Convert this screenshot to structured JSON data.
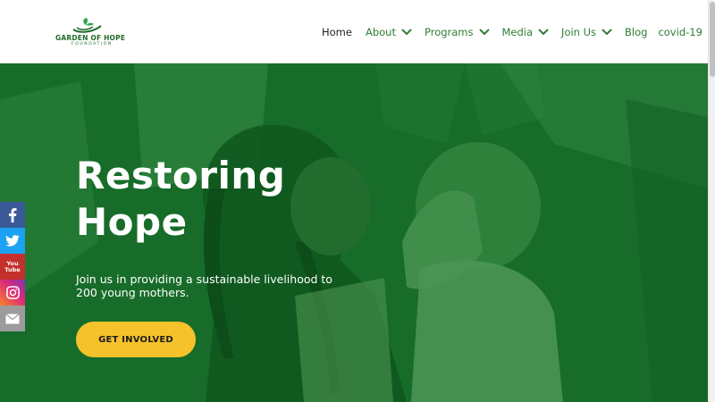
{
  "brand": {
    "title": "GARDEN OF HOPE",
    "subtitle": "FOUNDATION",
    "color": "#1f6b2a"
  },
  "nav": {
    "items": [
      {
        "label": "Home",
        "active": true,
        "dropdown": false
      },
      {
        "label": "About",
        "active": false,
        "dropdown": true
      },
      {
        "label": "Programs",
        "active": false,
        "dropdown": true
      },
      {
        "label": "Media",
        "active": false,
        "dropdown": true
      },
      {
        "label": "Join Us",
        "active": false,
        "dropdown": true
      },
      {
        "label": "Blog",
        "active": false,
        "dropdown": false
      },
      {
        "label": "covid-19",
        "active": false,
        "dropdown": false
      }
    ],
    "link_color": "#2f7d32",
    "active_color": "#222222"
  },
  "hero": {
    "title_line1": "Restoring",
    "title_line2": "Hope",
    "subtitle": "Join us in providing a sustainable livelihood to 200 young mothers.",
    "cta_label": "GET INVOLVED",
    "overlay_color": "#1d6a2c",
    "cta_color": "#f6c22b"
  },
  "social": [
    {
      "name": "facebook",
      "icon": "facebook-icon",
      "color": "#3b5998"
    },
    {
      "name": "twitter",
      "icon": "twitter-icon",
      "color": "#1da1f2"
    },
    {
      "name": "youtube",
      "icon": "youtube-icon",
      "label_top": "You",
      "label_bottom": "Tube",
      "color": "#c4302b"
    },
    {
      "name": "instagram",
      "icon": "instagram-icon",
      "color": "#dd2a7b"
    },
    {
      "name": "email",
      "icon": "email-icon",
      "color": "#9c9c9c"
    }
  ]
}
